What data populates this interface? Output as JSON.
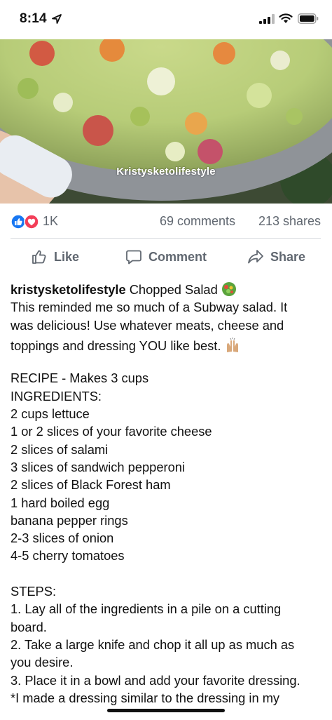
{
  "status_bar": {
    "time": "8:14",
    "icons": [
      "location-arrow-icon",
      "cellular-signal-icon",
      "wifi-icon",
      "battery-icon"
    ]
  },
  "photo": {
    "watermark": "Kristysketolifestyle",
    "description_icon": "salad-photo"
  },
  "reactions": {
    "icons": [
      "like-reaction-icon",
      "love-reaction-icon"
    ],
    "count": "1K",
    "comments": "69 comments",
    "shares": "213 shares"
  },
  "actions": {
    "like": "Like",
    "comment": "Comment",
    "share": "Share"
  },
  "post": {
    "author": "kristysketolifestyle",
    "title": " Chopped Salad ",
    "intro": [
      "This reminded me so much of a Subway salad. It",
      "was delicious! Use whatever meats, cheese and",
      "toppings and dressing YOU like best. "
    ],
    "recipe_header": "RECIPE - Makes 3 cups",
    "ingredients_header": "INGREDIENTS:",
    "ingredients": [
      "2 cups lettuce",
      "1 or 2 slices of your favorite cheese",
      "2 slices of salami",
      "3 slices of sandwich pepperoni",
      "2 slices of Black Forest ham",
      "1 hard boiled egg",
      "banana pepper rings",
      "2-3 slices of onion",
      "4-5 cherry tomatoes"
    ],
    "steps_header": "STEPS:",
    "steps_lines": [
      "1. Lay all of the ingredients in a pile on a cutting",
      "board.",
      "2. Take a large knife and chop it all up as much as",
      "you desire.",
      "3. Place it in a bowl and add your favorite dressing.",
      "*I made a dressing similar to the dressing in my"
    ]
  },
  "colors": {
    "like_blue": "#1877f2",
    "love_red": "#f33e58",
    "meta_gray": "#606770",
    "divider": "#dadde1"
  }
}
